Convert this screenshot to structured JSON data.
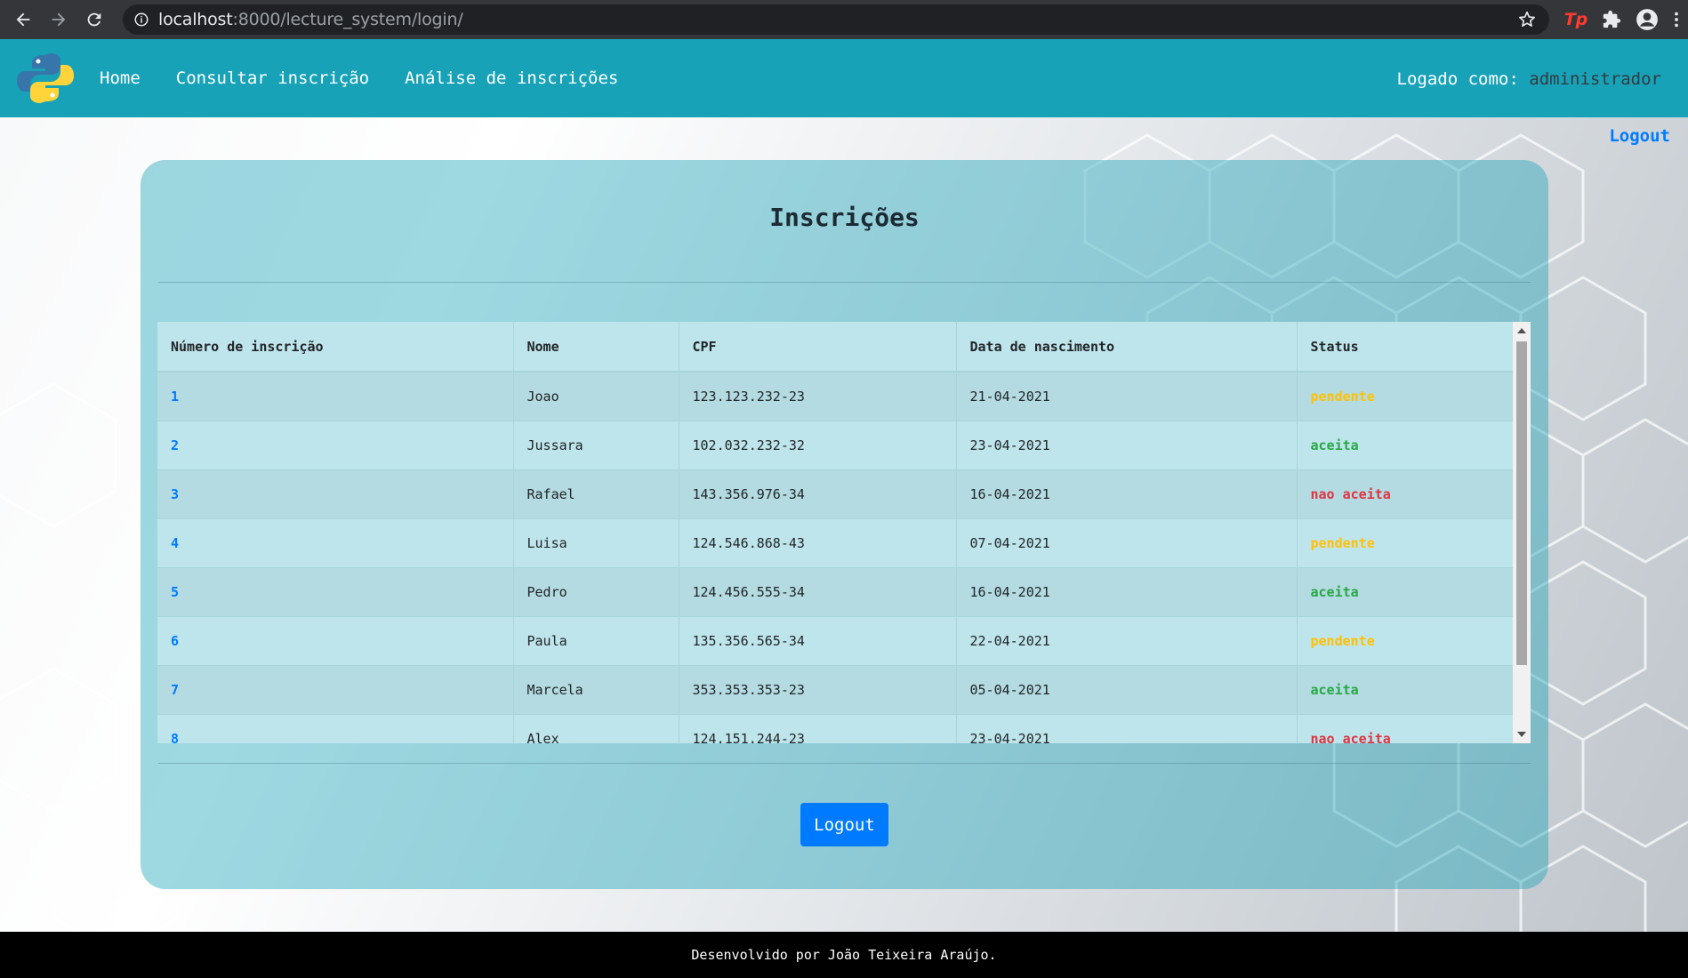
{
  "browser": {
    "url_host": "localhost",
    "url_rest": ":8000/lecture_system/login/",
    "ext_tp": "Tp"
  },
  "navbar": {
    "home": "Home",
    "consultar": "Consultar inscrição",
    "analise": "Análise de inscrições",
    "logged_label": "Logado como:",
    "logged_user": "administrador"
  },
  "top_logout": "Logout",
  "card": {
    "title": "Inscrições",
    "logout_button": "Logout"
  },
  "table": {
    "headers": [
      "Número de inscrição",
      "Nome",
      "CPF",
      "Data de nascimento",
      "Status"
    ],
    "rows": [
      {
        "num": "1",
        "nome": "Joao",
        "cpf": "123.123.232-23",
        "data": "21-04-2021",
        "status": "pendente"
      },
      {
        "num": "2",
        "nome": "Jussara",
        "cpf": "102.032.232-32",
        "data": "23-04-2021",
        "status": "aceita"
      },
      {
        "num": "3",
        "nome": "Rafael",
        "cpf": "143.356.976-34",
        "data": "16-04-2021",
        "status": "nao aceita"
      },
      {
        "num": "4",
        "nome": "Luisa",
        "cpf": "124.546.868-43",
        "data": "07-04-2021",
        "status": "pendente"
      },
      {
        "num": "5",
        "nome": "Pedro",
        "cpf": "124.456.555-34",
        "data": "16-04-2021",
        "status": "aceita"
      },
      {
        "num": "6",
        "nome": "Paula",
        "cpf": "135.356.565-34",
        "data": "22-04-2021",
        "status": "pendente"
      },
      {
        "num": "7",
        "nome": "Marcela",
        "cpf": "353.353.353-23",
        "data": "05-04-2021",
        "status": "aceita"
      },
      {
        "num": "8",
        "nome": "Alex",
        "cpf": "124.151.244-23",
        "data": "23-04-2021",
        "status": "nao aceita"
      }
    ]
  },
  "footer": "Desenvolvido por João Teixeira Araújo.",
  "colors": {
    "navbar": "#17a2b8",
    "link": "#007bff",
    "pendente": "#ffc107",
    "aceita": "#28a745",
    "nao_aceita": "#dc3545"
  }
}
